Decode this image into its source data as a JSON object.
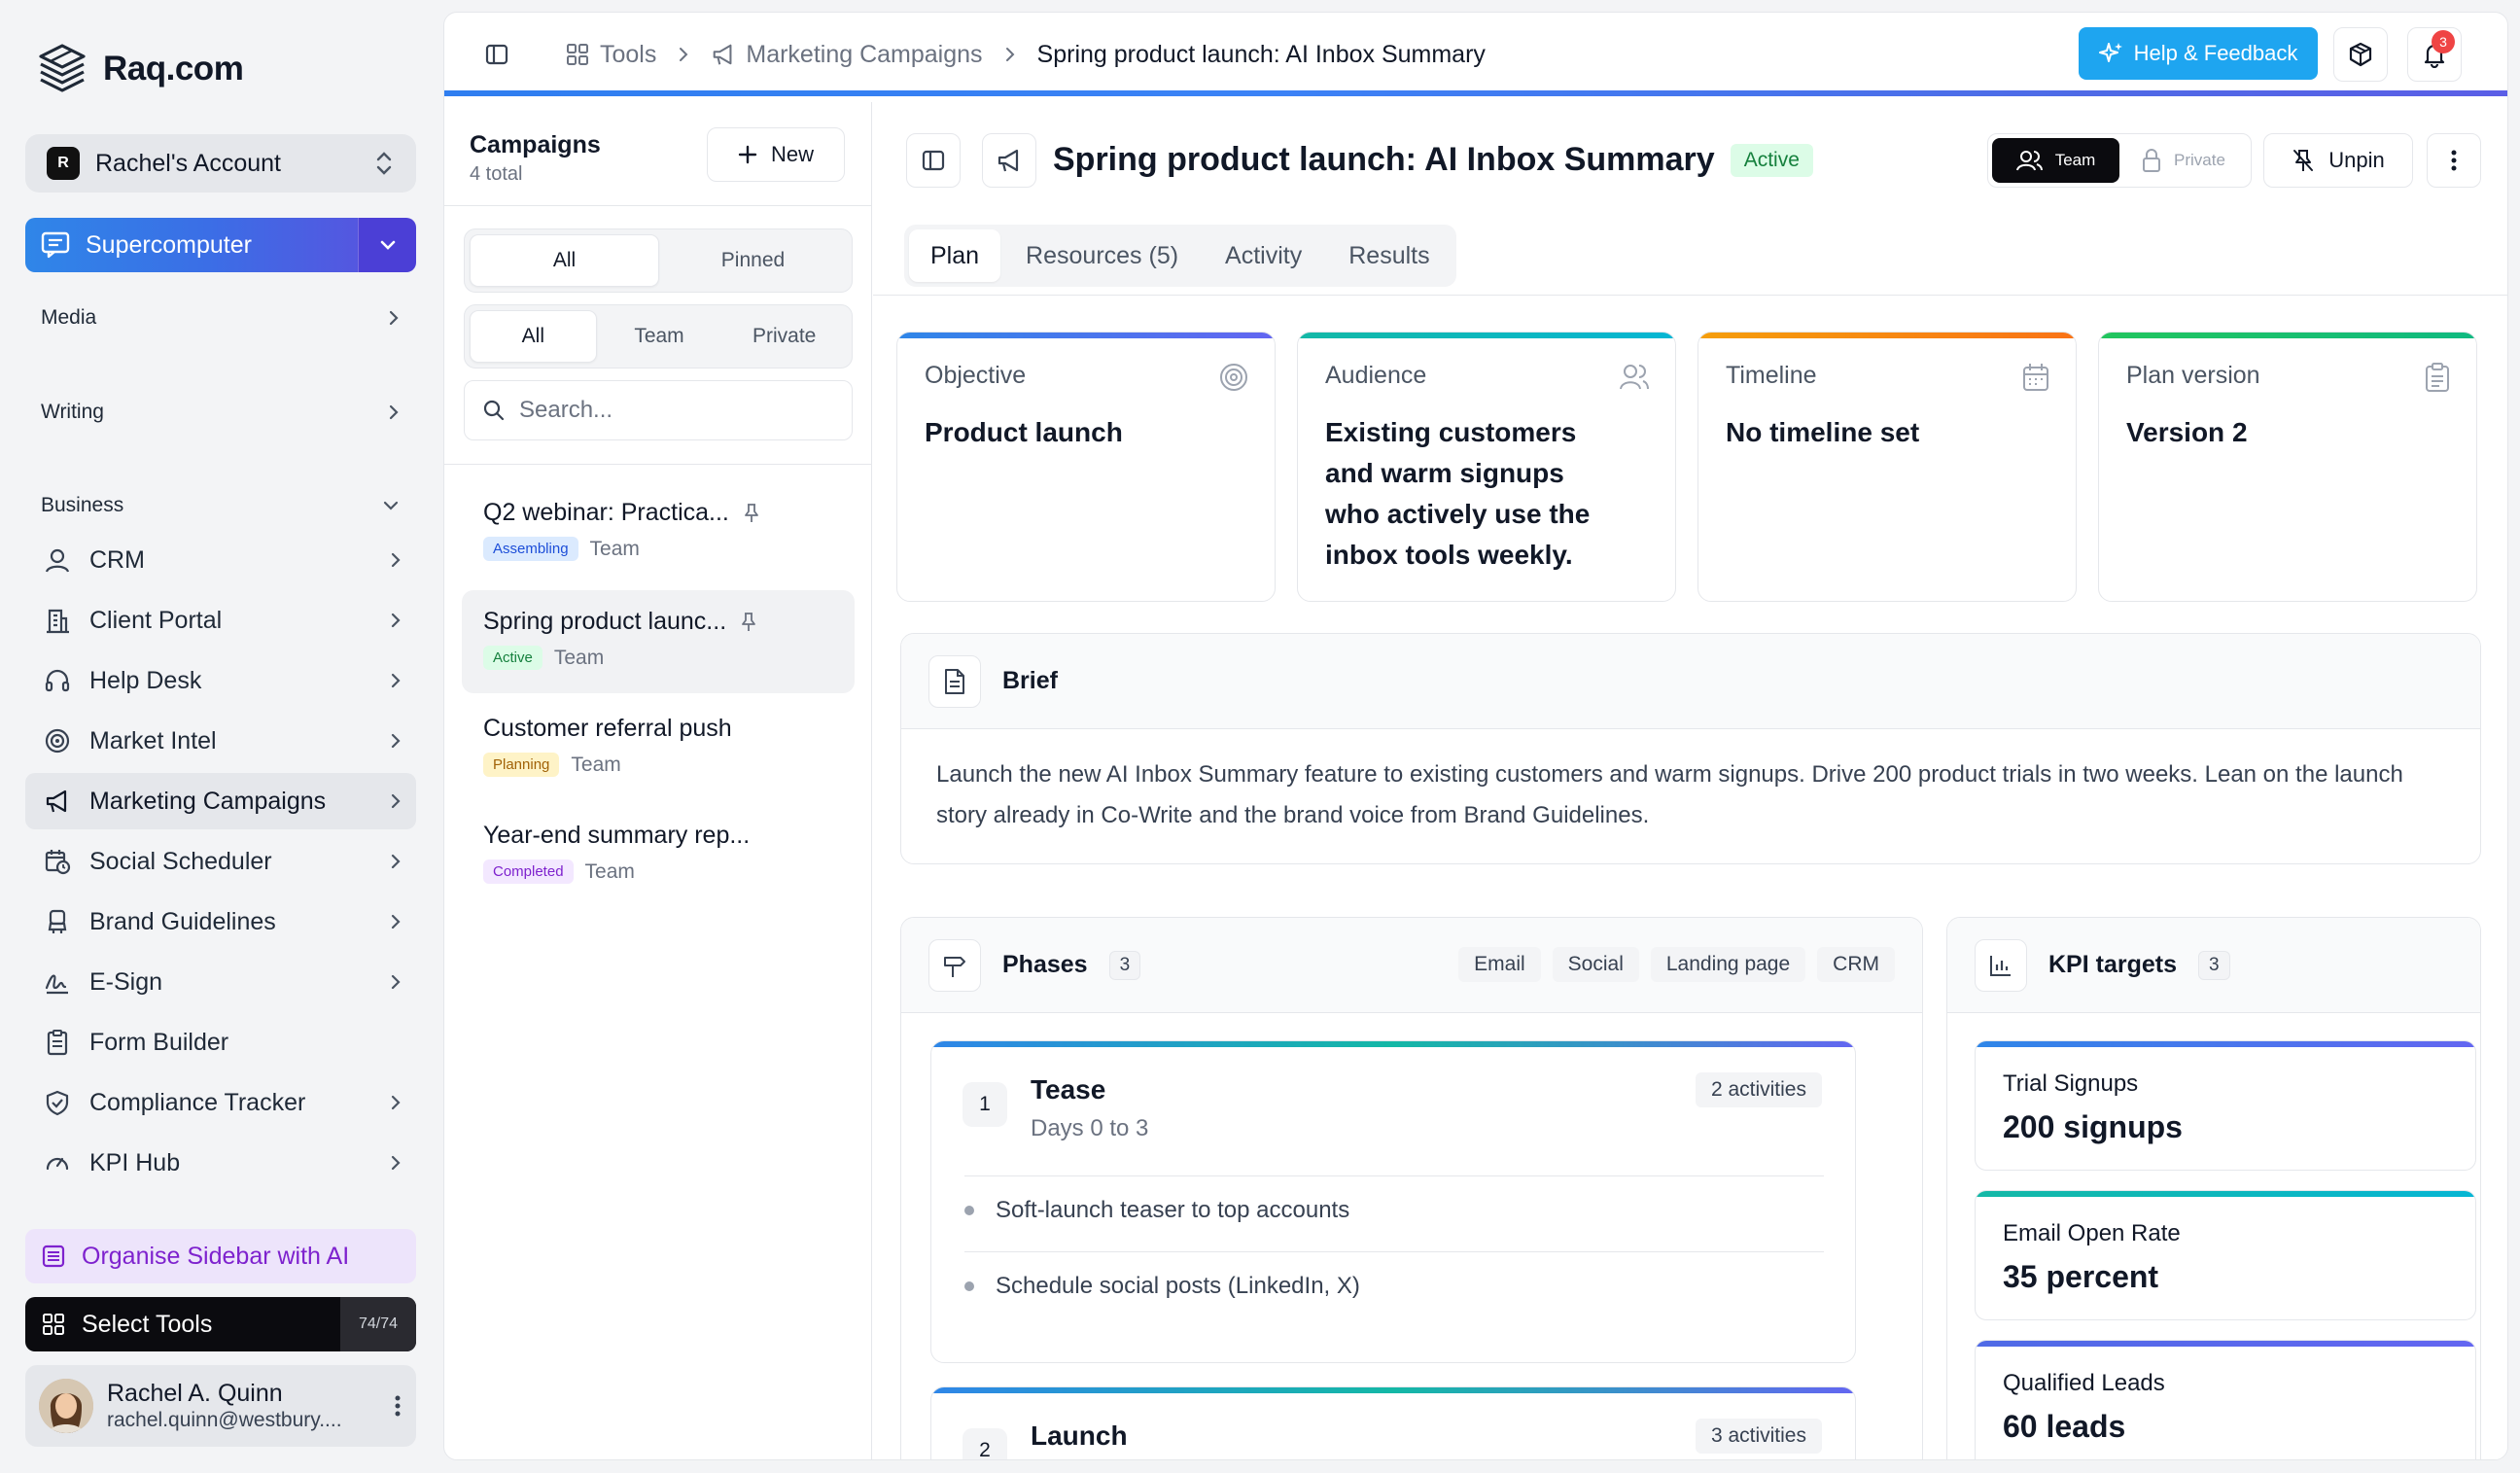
{
  "brand": {
    "name": "Raq.com"
  },
  "account": {
    "initial": "R",
    "name": "Rachel's Account"
  },
  "supercomputer": {
    "label": "Supercomputer"
  },
  "sidebar": {
    "sections": [
      {
        "label": "Media"
      },
      {
        "label": "Writing"
      },
      {
        "label": "Business"
      }
    ],
    "items": [
      {
        "label": "CRM",
        "icon": "user-circle-icon"
      },
      {
        "label": "Client Portal",
        "icon": "building-icon"
      },
      {
        "label": "Help Desk",
        "icon": "headset-icon"
      },
      {
        "label": "Market Intel",
        "icon": "target-icon"
      },
      {
        "label": "Marketing Campaigns",
        "icon": "megaphone-icon"
      },
      {
        "label": "Social Scheduler",
        "icon": "calendar-clock-icon"
      },
      {
        "label": "Brand Guidelines",
        "icon": "stamp-icon"
      },
      {
        "label": "E-Sign",
        "icon": "signature-icon"
      },
      {
        "label": "Form Builder",
        "icon": "clipboard-icon"
      },
      {
        "label": "Compliance Tracker",
        "icon": "shield-check-icon"
      },
      {
        "label": "KPI Hub",
        "icon": "gauge-icon"
      }
    ],
    "organise": "Organise Sidebar with AI",
    "select_tools": "Select Tools",
    "tools_count": "74/74"
  },
  "user": {
    "name": "Rachel A. Quinn",
    "email": "rachel.quinn@westbury...."
  },
  "breadcrumb": {
    "tools": "Tools",
    "campaigns": "Marketing Campaigns",
    "current": "Spring product launch: AI Inbox Summary"
  },
  "topbar": {
    "help": "Help & Feedback",
    "notifications": "3"
  },
  "campaigns": {
    "title": "Campaigns",
    "subtitle": "4 total",
    "new_label": "New",
    "filter1": [
      "All",
      "Pinned"
    ],
    "filter2": [
      "All",
      "Team",
      "Private"
    ],
    "search_placeholder": "Search...",
    "items": [
      {
        "name": "Q2 webinar: Practica...",
        "status": "Assembling",
        "visibility": "Team",
        "pinned": true
      },
      {
        "name": "Spring product launc...",
        "status": "Active",
        "visibility": "Team",
        "pinned": true
      },
      {
        "name": "Customer referral push",
        "status": "Planning",
        "visibility": "Team",
        "pinned": false
      },
      {
        "name": "Year-end summary rep...",
        "status": "Completed",
        "visibility": "Team",
        "pinned": false
      }
    ]
  },
  "detail": {
    "title": "Spring product launch: AI Inbox Summary",
    "status": "Active",
    "visibility": [
      "Team",
      "Private"
    ],
    "unpin": "Unpin",
    "tabs": [
      "Plan",
      "Resources (5)",
      "Activity",
      "Results"
    ],
    "cards": [
      {
        "label": "Objective",
        "value": "Product launch",
        "color": "#4f6ae6"
      },
      {
        "label": "Audience",
        "value": "Existing customers and warm signups who actively use the inbox tools weekly.",
        "color": "#14b8a6"
      },
      {
        "label": "Timeline",
        "value": "No timeline set",
        "color": "#f97316"
      },
      {
        "label": "Plan version",
        "value": "Version 2",
        "color": "#22c55e"
      }
    ],
    "brief": {
      "title": "Brief",
      "text": "Launch the new AI Inbox Summary feature to existing customers and warm signups. Drive 200 product trials in two weeks. Lean on the launch story already in Co-Write and the brand voice from Brand Guidelines."
    },
    "phases": {
      "title": "Phases",
      "count": "3",
      "tags": [
        "Email",
        "Social",
        "Landing page",
        "CRM"
      ],
      "items": [
        {
          "num": "1",
          "name": "Tease",
          "days": "Days 0 to 3",
          "activities_label": "2 activities",
          "activities": [
            "Soft-launch teaser to top accounts",
            "Schedule social posts (LinkedIn, X)"
          ]
        },
        {
          "num": "2",
          "name": "Launch",
          "days": "",
          "activities_label": "3 activities",
          "activities": []
        }
      ]
    },
    "kpis": {
      "title": "KPI targets",
      "count": "3",
      "items": [
        {
          "label": "Trial Signups",
          "value": "200 signups",
          "color": "#4f6ae6"
        },
        {
          "label": "Email Open Rate",
          "value": "35 percent",
          "color": "#14b8a6"
        },
        {
          "label": "Qualified Leads",
          "value": "60 leads",
          "color": "#5b6ee6"
        }
      ]
    }
  }
}
